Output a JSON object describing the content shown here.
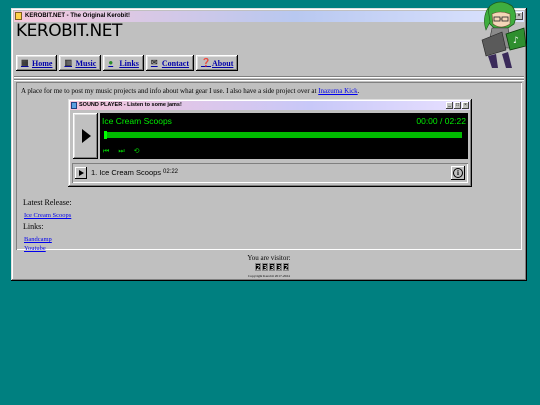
{
  "window": {
    "title": "KEROBIT.NET - The Original Kerobit!",
    "controls": [
      "_",
      "□",
      "×"
    ]
  },
  "site_title": "KEROBIT.NET",
  "nav": [
    {
      "label": "Home",
      "icon": "home-icon"
    },
    {
      "label": "Music",
      "icon": "music-icon"
    },
    {
      "label": "Links",
      "icon": "globe-icon"
    },
    {
      "label": "Contact",
      "icon": "mail-icon"
    },
    {
      "label": "About",
      "icon": "help-icon"
    }
  ],
  "intro": {
    "text": "A place for me to post my music projects and info about what gear I use. I also have a side project over at ",
    "link_text": "Inazuma Kick",
    "trailing": "."
  },
  "player": {
    "title": "SOUND PLAYER - Listen to some jams!",
    "controls": [
      "_",
      "□",
      "×"
    ],
    "now_playing": "Ice Cream Scoops",
    "time_display": "00:00 / 02:22",
    "progress": 0.0,
    "playlist": [
      {
        "name": "1. Ice Cream Scoops",
        "duration": "02:22"
      }
    ]
  },
  "latest_release": {
    "heading": "Latest Release:",
    "link_text": "Ice Cream Scoops"
  },
  "links": {
    "heading": "Links:",
    "items": [
      "Bandcamp",
      "Youtube"
    ]
  },
  "footer": {
    "visitor_text": "You are visitor:",
    "counter_digits": [
      "2",
      "3",
      "3",
      "3",
      "2"
    ],
    "copyright": "Copyright Kerobit 2017-2024"
  },
  "colors": {
    "desktop": "#008080",
    "window": "#c0c0c0",
    "player_text": "#00ee00",
    "link": "#0000ee"
  }
}
